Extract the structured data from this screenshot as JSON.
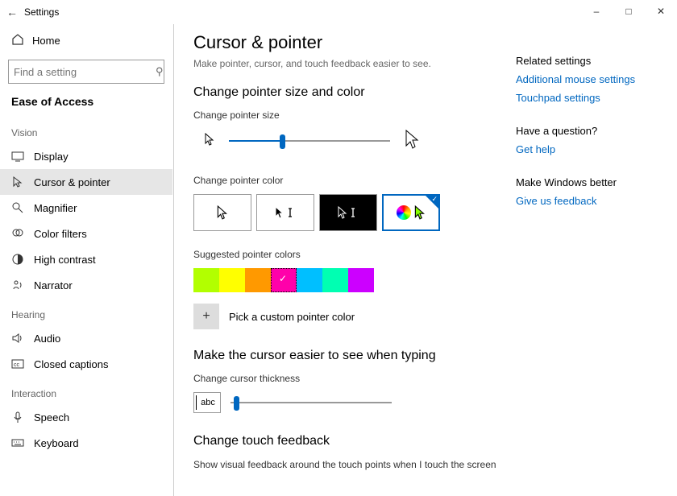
{
  "window": {
    "title": "Settings"
  },
  "sidebar": {
    "home": "Home",
    "search_placeholder": "Find a setting",
    "category": "Ease of Access",
    "groups": [
      {
        "label": "Vision",
        "items": [
          "Display",
          "Cursor & pointer",
          "Magnifier",
          "Color filters",
          "High contrast",
          "Narrator"
        ],
        "selected": "Cursor & pointer"
      },
      {
        "label": "Hearing",
        "items": [
          "Audio",
          "Closed captions"
        ]
      },
      {
        "label": "Interaction",
        "items": [
          "Speech",
          "Keyboard"
        ]
      }
    ]
  },
  "page": {
    "title": "Cursor & pointer",
    "subtitle": "Make pointer, cursor, and touch feedback easier to see.",
    "section_size_color": "Change pointer size and color",
    "label_size": "Change pointer size",
    "slider_size_percent": 33,
    "label_color": "Change pointer color",
    "color_options": [
      "white",
      "black",
      "inverted",
      "custom"
    ],
    "color_selected": "custom",
    "label_suggested": "Suggested pointer colors",
    "suggested_colors": [
      "#b2ff00",
      "#ffff00",
      "#ff9900",
      "#ff00aa",
      "#00bfff",
      "#00ffb2",
      "#cc00ff"
    ],
    "suggested_selected_index": 3,
    "custom_label": "Pick a custom pointer color",
    "section_cursor": "Make the cursor easier to see when typing",
    "label_thickness": "Change cursor thickness",
    "thickness_preview": "abc",
    "slider_thickness_percent": 2,
    "section_touch": "Change touch feedback",
    "touch_desc": "Show visual feedback around the touch points when I touch the screen"
  },
  "right": {
    "related_head": "Related settings",
    "related_links": [
      "Additional mouse settings",
      "Touchpad settings"
    ],
    "question_head": "Have a question?",
    "question_link": "Get help",
    "better_head": "Make Windows better",
    "better_link": "Give us feedback"
  }
}
